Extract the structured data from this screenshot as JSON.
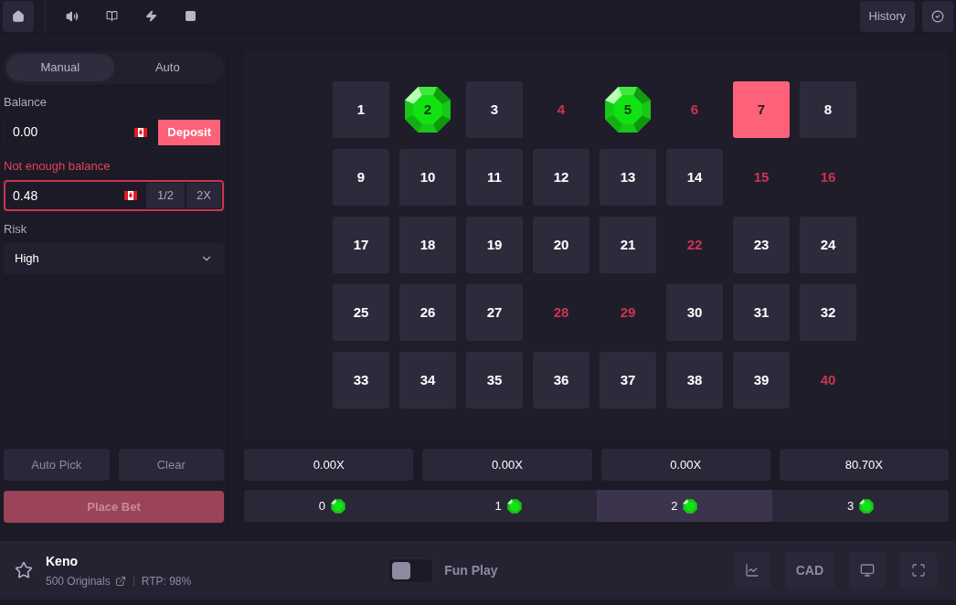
{
  "top_bar": {
    "history_button": "History"
  },
  "mode_tabs": [
    {
      "label": "Manual",
      "selected": true
    },
    {
      "label": "Auto",
      "selected": false
    }
  ],
  "balance": {
    "label": "Balance",
    "value": "0.00",
    "deposit_button": "Deposit"
  },
  "bet": {
    "error": "Not enough balance",
    "value": "0.48",
    "half_button": "1/2",
    "double_button": "2X",
    "invalid": true
  },
  "risk": {
    "label": "Risk",
    "value": "High"
  },
  "actions": {
    "auto_pick": "Auto Pick",
    "clear": "Clear",
    "place_bet": "Place Bet",
    "place_bet_disabled": true
  },
  "tiles": [
    {
      "label": "1",
      "kind": "normal"
    },
    {
      "label": "2",
      "kind": "gem"
    },
    {
      "label": "3",
      "kind": "normal"
    },
    {
      "label": "4",
      "kind": "drawn"
    },
    {
      "label": "5",
      "kind": "gem"
    },
    {
      "label": "6",
      "kind": "drawn"
    },
    {
      "label": "7",
      "kind": "picked"
    },
    {
      "label": "8",
      "kind": "normal"
    },
    {
      "label": "9",
      "kind": "normal"
    },
    {
      "label": "10",
      "kind": "normal"
    },
    {
      "label": "11",
      "kind": "normal"
    },
    {
      "label": "12",
      "kind": "normal"
    },
    {
      "label": "13",
      "kind": "normal"
    },
    {
      "label": "14",
      "kind": "normal"
    },
    {
      "label": "15",
      "kind": "drawn"
    },
    {
      "label": "16",
      "kind": "drawn"
    },
    {
      "label": "17",
      "kind": "normal"
    },
    {
      "label": "18",
      "kind": "normal"
    },
    {
      "label": "19",
      "kind": "normal"
    },
    {
      "label": "20",
      "kind": "normal"
    },
    {
      "label": "21",
      "kind": "normal"
    },
    {
      "label": "22",
      "kind": "drawn"
    },
    {
      "label": "23",
      "kind": "normal"
    },
    {
      "label": "24",
      "kind": "normal"
    },
    {
      "label": "25",
      "kind": "normal"
    },
    {
      "label": "26",
      "kind": "normal"
    },
    {
      "label": "27",
      "kind": "normal"
    },
    {
      "label": "28",
      "kind": "drawn"
    },
    {
      "label": "29",
      "kind": "drawn"
    },
    {
      "label": "30",
      "kind": "normal"
    },
    {
      "label": "31",
      "kind": "normal"
    },
    {
      "label": "32",
      "kind": "normal"
    },
    {
      "label": "33",
      "kind": "normal"
    },
    {
      "label": "34",
      "kind": "normal"
    },
    {
      "label": "35",
      "kind": "normal"
    },
    {
      "label": "36",
      "kind": "normal"
    },
    {
      "label": "37",
      "kind": "normal"
    },
    {
      "label": "38",
      "kind": "normal"
    },
    {
      "label": "39",
      "kind": "normal"
    },
    {
      "label": "40",
      "kind": "drawn"
    }
  ],
  "payouts": [
    "0.00X",
    "0.00X",
    "0.00X",
    "80.70X"
  ],
  "hits": [
    {
      "label": "0",
      "selected": false
    },
    {
      "label": "1",
      "selected": false
    },
    {
      "label": "2",
      "selected": true
    },
    {
      "label": "3",
      "selected": false
    }
  ],
  "footer": {
    "game": "Keno",
    "provider": "500 Originals",
    "rtp": "RTP: 98%",
    "fun_play": {
      "label": "Fun Play",
      "on": false
    },
    "currency_button": "CAD"
  }
}
